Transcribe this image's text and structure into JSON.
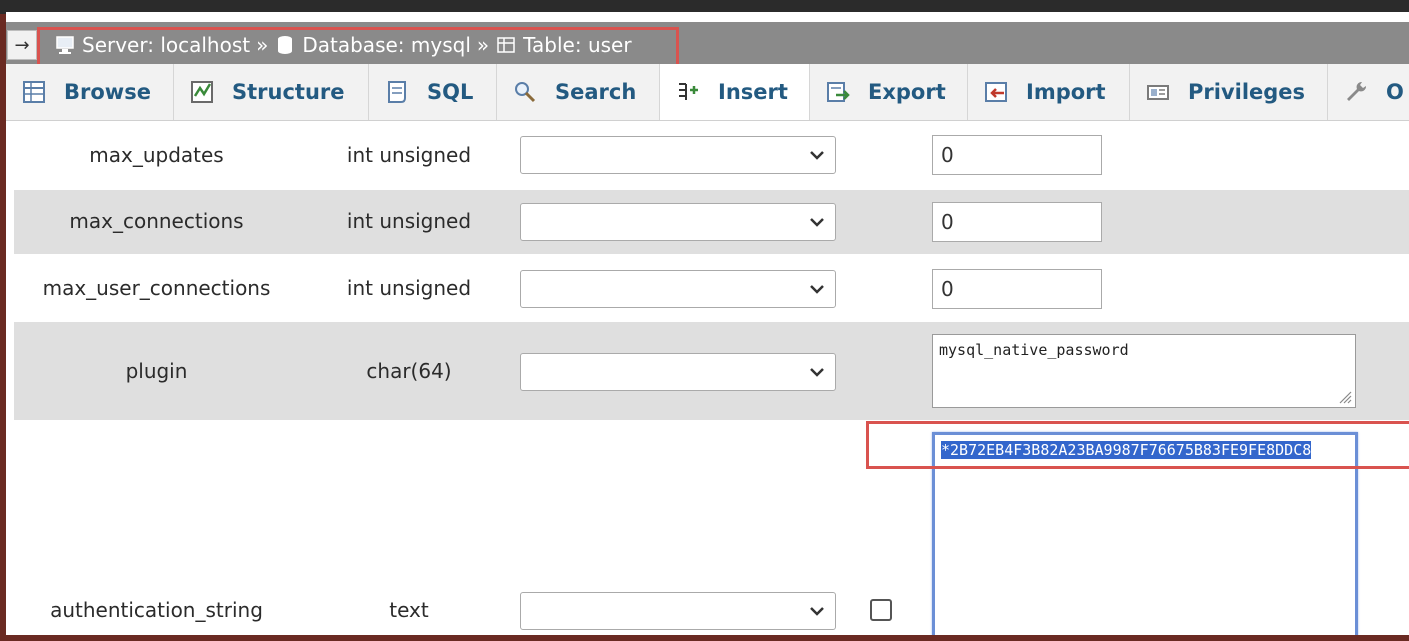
{
  "breadcrumb": {
    "server": "Server: localhost",
    "database": "Database: mysql",
    "table": "Table: user",
    "separator": "»",
    "collapse_glyph": "→"
  },
  "tabs": [
    {
      "label": "Browse",
      "icon": "browse-icon"
    },
    {
      "label": "Structure",
      "icon": "structure-icon"
    },
    {
      "label": "SQL",
      "icon": "sql-icon"
    },
    {
      "label": "Search",
      "icon": "search-icon"
    },
    {
      "label": "Insert",
      "icon": "insert-icon",
      "active": true
    },
    {
      "label": "Export",
      "icon": "export-icon"
    },
    {
      "label": "Import",
      "icon": "import-icon"
    },
    {
      "label": "Privileges",
      "icon": "privileges-icon"
    },
    {
      "label": "O",
      "icon": "operations-icon"
    }
  ],
  "rows": [
    {
      "field": "max_updates",
      "type": "int unsigned",
      "function": "",
      "value": "0"
    },
    {
      "field": "max_connections",
      "type": "int unsigned",
      "function": "",
      "value": "0"
    },
    {
      "field": "max_user_connections",
      "type": "int unsigned",
      "function": "",
      "value": "0"
    },
    {
      "field": "plugin",
      "type": "char(64)",
      "function": "",
      "value": "mysql_native_password"
    },
    {
      "field": "authentication_string",
      "type": "text",
      "function": "",
      "value": "*2B72EB4F3B82A23BA9987F76675B83FE9FE8DDC8"
    }
  ],
  "colors": {
    "tab_text": "#235a81",
    "breadcrumb_bar": "#8a8a8a",
    "row_alt": "#dfdfdf",
    "highlight_box": "#d9534f",
    "selection": "#3366cc"
  }
}
